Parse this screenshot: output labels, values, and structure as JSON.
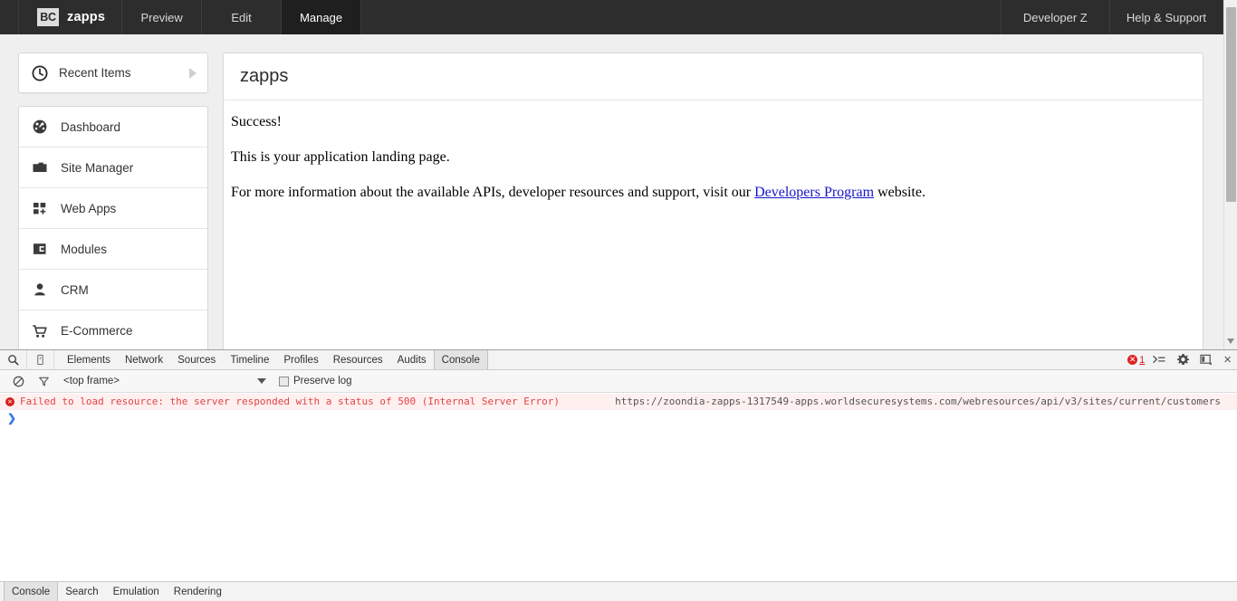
{
  "topnav": {
    "brand_badge": "BC",
    "brand_name": "zapps",
    "left_tabs": [
      {
        "label": "Preview",
        "active": false
      },
      {
        "label": "Edit",
        "active": false
      },
      {
        "label": "Manage",
        "active": true
      }
    ],
    "right_tabs": [
      {
        "label": "Developer Z"
      },
      {
        "label": "Help & Support"
      }
    ]
  },
  "sidebar": {
    "recent": {
      "label": "Recent Items",
      "icon": "clock-icon",
      "expander": "triangle-right-icon"
    },
    "items": [
      {
        "label": "Dashboard",
        "icon": "dashboard-gauge-icon"
      },
      {
        "label": "Site Manager",
        "icon": "folder-icon"
      },
      {
        "label": "Web Apps",
        "icon": "grid-plus-icon"
      },
      {
        "label": "Modules",
        "icon": "modules-block-icon"
      },
      {
        "label": "CRM",
        "icon": "person-icon"
      },
      {
        "label": "E-Commerce",
        "icon": "shopping-cart-icon"
      }
    ]
  },
  "content": {
    "title": "zapps",
    "paragraph_1": "Success!",
    "paragraph_2": "This is your application landing page.",
    "paragraph_3_pre": "For more information about the available APIs, developer resources and support, visit our ",
    "link_label": "Developers Program",
    "paragraph_3_post": " website."
  },
  "devtools": {
    "tools": [
      {
        "name": "inspect-element-icon"
      },
      {
        "name": "device-mode-icon"
      }
    ],
    "tabs": [
      {
        "label": "Elements",
        "active": false
      },
      {
        "label": "Network",
        "active": false
      },
      {
        "label": "Sources",
        "active": false
      },
      {
        "label": "Timeline",
        "active": false
      },
      {
        "label": "Profiles",
        "active": false
      },
      {
        "label": "Resources",
        "active": false
      },
      {
        "label": "Audits",
        "active": false
      },
      {
        "label": "Console",
        "active": true
      }
    ],
    "error_count": "1",
    "error_glyph": "✕",
    "right_icons": [
      {
        "name": "console-drawer-icon"
      },
      {
        "name": "settings-gear-icon"
      },
      {
        "name": "dock-position-icon"
      },
      {
        "name": "close-devtools-icon"
      }
    ],
    "close_glyph": "×",
    "filterbar": {
      "clear_icon": "clear-console-icon",
      "filter_icon": "filter-funnel-icon",
      "frame_value": "<top frame>",
      "preserve_log_label": "Preserve log",
      "preserve_log_checked": false
    },
    "console": {
      "rows": [
        {
          "level": "error",
          "message": "Failed to load resource: the server responded with a status of 500 (Internal Server Error)",
          "url": "https://zoondia-zapps-1317549-apps.worldsecuresystems.com/webresources/api/v3/sites/current/customers"
        }
      ],
      "prompt_caret": "❯"
    },
    "drawer_tabs": [
      {
        "label": "Console",
        "active": true
      },
      {
        "label": "Search",
        "active": false
      },
      {
        "label": "Emulation",
        "active": false
      },
      {
        "label": "Rendering",
        "active": false
      }
    ]
  },
  "colors": {
    "nav_bg": "#2d2d2d",
    "nav_active": "#1f1f1f",
    "link": "#1414c8",
    "error": "#e24444",
    "page_bg": "#efefef"
  }
}
